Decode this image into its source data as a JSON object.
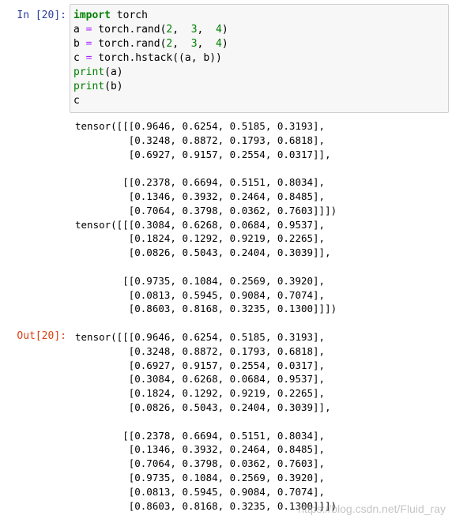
{
  "input_prompt": "In  [20]:",
  "output_prompt": "Out[20]:",
  "code_lines": [
    [
      {
        "t": "import",
        "c": "kw"
      },
      {
        "t": " torch",
        "c": ""
      }
    ],
    [
      {
        "t": "a ",
        "c": ""
      },
      {
        "t": "=",
        "c": "op"
      },
      {
        "t": " torch.rand(",
        "c": ""
      },
      {
        "t": "2",
        "c": "num"
      },
      {
        "t": ",  ",
        "c": ""
      },
      {
        "t": "3",
        "c": "num"
      },
      {
        "t": ",  ",
        "c": ""
      },
      {
        "t": "4",
        "c": "num"
      },
      {
        "t": ")",
        "c": ""
      }
    ],
    [
      {
        "t": "b ",
        "c": ""
      },
      {
        "t": "=",
        "c": "op"
      },
      {
        "t": " torch.rand(",
        "c": ""
      },
      {
        "t": "2",
        "c": "num"
      },
      {
        "t": ",  ",
        "c": ""
      },
      {
        "t": "3",
        "c": "num"
      },
      {
        "t": ",  ",
        "c": ""
      },
      {
        "t": "4",
        "c": "num"
      },
      {
        "t": ")",
        "c": ""
      }
    ],
    [
      {
        "t": "c ",
        "c": ""
      },
      {
        "t": "=",
        "c": "op"
      },
      {
        "t": " torch.hstack((a, b))",
        "c": ""
      }
    ],
    [
      {
        "t": "print",
        "c": "fn"
      },
      {
        "t": "(a)",
        "c": ""
      }
    ],
    [
      {
        "t": "print",
        "c": "fn"
      },
      {
        "t": "(b)",
        "c": ""
      }
    ],
    [
      {
        "t": "c",
        "c": ""
      }
    ]
  ],
  "stream_output": [
    "tensor([[[0.9646, 0.6254, 0.5185, 0.3193],",
    "         [0.3248, 0.8872, 0.1793, 0.6818],",
    "         [0.6927, 0.9157, 0.2554, 0.0317]],",
    "",
    "        [[0.2378, 0.6694, 0.5151, 0.8034],",
    "         [0.1346, 0.3932, 0.2464, 0.8485],",
    "         [0.7064, 0.3798, 0.0362, 0.7603]]])",
    "tensor([[[0.3084, 0.6268, 0.0684, 0.9537],",
    "         [0.1824, 0.1292, 0.9219, 0.2265],",
    "         [0.0826, 0.5043, 0.2404, 0.3039]],",
    "",
    "        [[0.9735, 0.1084, 0.2569, 0.3920],",
    "         [0.0813, 0.5945, 0.9084, 0.7074],",
    "         [0.8603, 0.8168, 0.3235, 0.1300]]])"
  ],
  "result_output": [
    "tensor([[[0.9646, 0.6254, 0.5185, 0.3193],",
    "         [0.3248, 0.8872, 0.1793, 0.6818],",
    "         [0.6927, 0.9157, 0.2554, 0.0317],",
    "         [0.3084, 0.6268, 0.0684, 0.9537],",
    "         [0.1824, 0.1292, 0.9219, 0.2265],",
    "         [0.0826, 0.5043, 0.2404, 0.3039]],",
    "",
    "        [[0.2378, 0.6694, 0.5151, 0.8034],",
    "         [0.1346, 0.3932, 0.2464, 0.8485],",
    "         [0.7064, 0.3798, 0.0362, 0.7603],",
    "         [0.9735, 0.1084, 0.2569, 0.3920],",
    "         [0.0813, 0.5945, 0.9084, 0.7074],",
    "         [0.8603, 0.8168, 0.3235, 0.1300]]])"
  ],
  "watermark": "https://blog.csdn.net/Fluid_ray",
  "colors": {
    "input_prompt": "#303f9f",
    "output_prompt": "#d84315",
    "keyword": "#008000",
    "operator": "#aa22ff",
    "number": "#008000"
  }
}
